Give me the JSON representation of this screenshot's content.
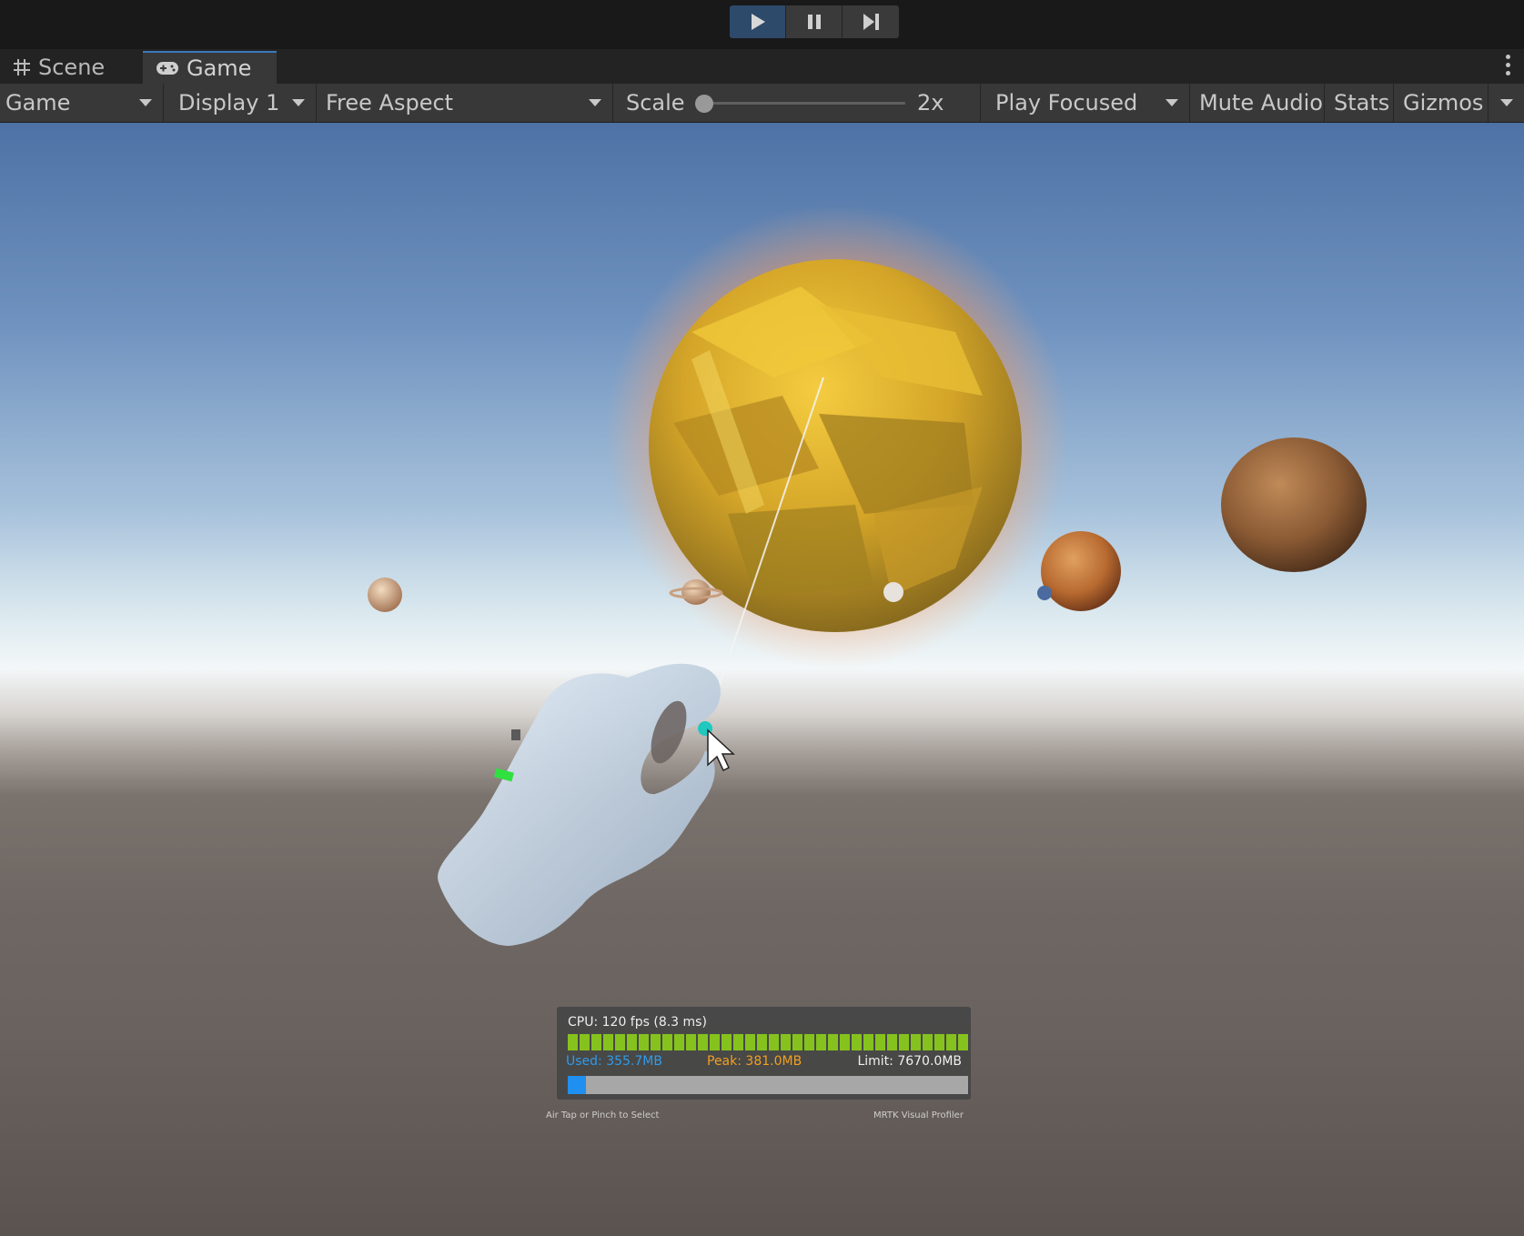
{
  "playbar": {
    "buttons": [
      {
        "name": "play",
        "icon": "play-icon",
        "active": true
      },
      {
        "name": "pause",
        "icon": "pause-icon",
        "active": false
      },
      {
        "name": "step",
        "icon": "step-icon",
        "active": false
      }
    ]
  },
  "tabs": [
    {
      "label": "Scene",
      "icon": "grid-icon",
      "active": false
    },
    {
      "label": "Game",
      "icon": "gamepad-icon",
      "active": true
    }
  ],
  "toolbar": {
    "game_label": "Game",
    "display_label": "Display 1",
    "aspect_label": "Free Aspect",
    "scale_label": "Scale",
    "scale_value": "2x",
    "play_mode_label": "Play Focused",
    "mute_label": "Mute Audio",
    "stats_label": "Stats",
    "gizmos_label": "Gizmos"
  },
  "hud": {
    "cpu_text": "CPU: 120 fps (8.3 ms)",
    "used_text": "Used: 355.7MB",
    "peak_text": "Peak: 381.0MB",
    "limit_text": "Limit: 7670.0MB",
    "memory_used_fraction": 0.046,
    "footer_left": "Air Tap or Pinch to Select",
    "footer_right": "MRTK Visual Profiler"
  },
  "colors": {
    "accent": "#3a79bb",
    "cpu_bar": "#86c21e",
    "used": "#2f9bea",
    "peak": "#f0a020"
  }
}
